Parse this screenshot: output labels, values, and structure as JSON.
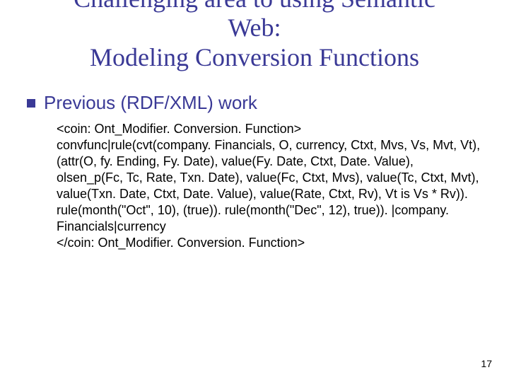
{
  "title": "Challenging area to using Semantic\nWeb:\nModeling Conversion Functions",
  "bullet": "Previous (RDF/XML) work",
  "code": "<coin: Ont_Modifier. Conversion. Function>\nconvfunc|rule(cvt(company. Financials, O, currency, Ctxt, Mvs, Vs, Mvt, Vt), (attr(O, fy. Ending, Fy. Date), value(Fy. Date, Ctxt, Date. Value), olsen_p(Fc, Tc, Rate, Txn. Date), value(Fc, Ctxt, Mvs), value(Tc, Ctxt, Mvt), value(Txn. Date, Ctxt, Date. Value), value(Rate, Ctxt, Rv), Vt is Vs * Rv)). rule(month(\"Oct\", 10), (true)). rule(month(\"Dec\", 12), true)). |company. Financials|currency\n</coin: Ont_Modifier. Conversion. Function>",
  "page_number": "17"
}
